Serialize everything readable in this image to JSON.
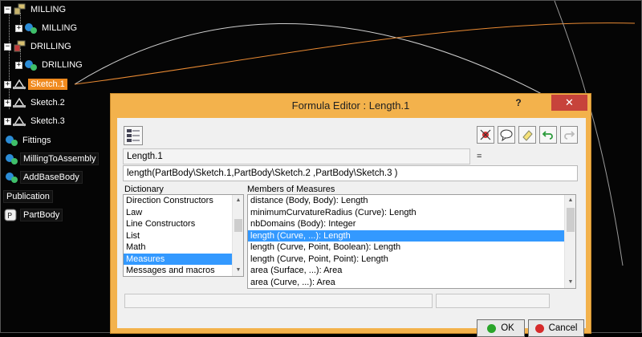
{
  "tree": {
    "nodes": [
      {
        "label": "MILLING",
        "icon": "milling-icon"
      },
      {
        "label": "MILLING",
        "icon": "gear-icon"
      },
      {
        "label": "DRILLING",
        "icon": "drilling-icon"
      },
      {
        "label": "DRILLING",
        "icon": "gear-icon"
      },
      {
        "label": "Sketch.1",
        "icon": "sketch-icon",
        "selected": true
      },
      {
        "label": "Sketch.2",
        "icon": "sketch-icon"
      },
      {
        "label": "Sketch.3",
        "icon": "sketch-icon"
      },
      {
        "label": "Fittings",
        "icon": "gear-icon"
      },
      {
        "label": "MillingToAssembly",
        "icon": "gear-icon"
      },
      {
        "label": "AddBaseBody",
        "icon": "gear-icon"
      },
      {
        "label": "Publication",
        "icon": ""
      },
      {
        "label": "PartBody",
        "icon": "partbody-icon"
      }
    ]
  },
  "dialog": {
    "title": "Formula Editor : Length.1",
    "help": "?",
    "close": "✕",
    "parameter_name": "Length.1",
    "equals": "=",
    "formula": "length(PartBody\\Sketch.1,PartBody\\Sketch.2 ,PartBody\\Sketch.3  )",
    "dictionary_label": "Dictionary",
    "dictionary": [
      "Direction Constructors",
      "Law",
      "Line Constructors",
      "List",
      "Math",
      "Measures",
      "Messages and macros"
    ],
    "dictionary_selected": "Measures",
    "members_label": "Members of Measures",
    "members": [
      "distance (Body, Body): Length",
      "minimumCurvatureRadius (Curve): Length",
      "nbDomains (Body): Integer",
      "length (Curve, ...): Length",
      "length (Curve, Point, Boolean): Length",
      "length (Curve, Point, Point): Length",
      "area (Surface, ...): Area",
      "area (Curve, ...): Area"
    ],
    "members_selected": "length (Curve, ...): Length",
    "bottom_field_left": "",
    "bottom_field_right": "",
    "ok_label": "OK",
    "cancel_label": "Cancel"
  },
  "colors": {
    "dialog_frame": "#f3b24c",
    "selection": "#3399ff",
    "tree_selection": "#f08a1e",
    "ok_dot": "#2aa52a",
    "cancel_dot": "#d62b2b"
  }
}
